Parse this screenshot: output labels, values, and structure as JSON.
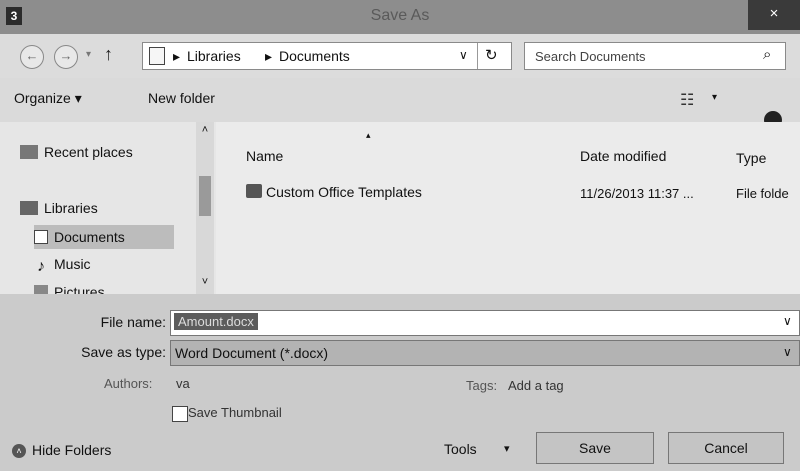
{
  "window": {
    "title": "Save As",
    "app_icon": "⬛",
    "close_label": "×"
  },
  "nav": {
    "back_icon": "←",
    "forward_icon": "→",
    "recent_icon": "▾",
    "up_icon": "↑",
    "breadcrumbs": [
      "Libraries",
      "Documents"
    ],
    "crumb_separator": "▸",
    "dropdown_icon": "∨",
    "refresh_icon": "↻",
    "search_placeholder": "Search Documents",
    "search_icon": "⌕"
  },
  "toolbar": {
    "organize_label": "Organize ▾",
    "new_folder_label": "New folder",
    "view_icon": "☷",
    "view_dropdown_icon": "▾"
  },
  "sidebar": {
    "items": [
      {
        "label": "Recent places"
      },
      {
        "label": "Libraries"
      },
      {
        "label": "Documents"
      },
      {
        "label": "Music"
      },
      {
        "label": "Pictures"
      }
    ],
    "scroll_up": "˄",
    "scroll_down": "˅"
  },
  "files": {
    "columns": [
      "Name",
      "Date modified",
      "Type"
    ],
    "sort_indicator": "▴",
    "rows": [
      {
        "name": "Custom Office Templates",
        "date": "11/26/2013 11:37 ...",
        "type": "File folde"
      }
    ]
  },
  "form": {
    "file_name_label": "File name:",
    "file_name_value": "Amount.docx",
    "save_type_label": "Save as type:",
    "save_type_value": "Word Document (*.docx)",
    "authors_label": "Authors:",
    "authors_value": "va",
    "tags_label": "Tags:",
    "tags_value": "Add a tag",
    "thumbnail_label": "Save Thumbnail",
    "thumbnail_checked": false,
    "dropdown_icon": "∨"
  },
  "footer": {
    "hide_folders_label": "Hide Folders",
    "hide_folders_icon": "˄",
    "tools_label": "Tools",
    "tools_dropdown_icon": "▾",
    "save_label": "Save",
    "cancel_label": "Cancel"
  }
}
